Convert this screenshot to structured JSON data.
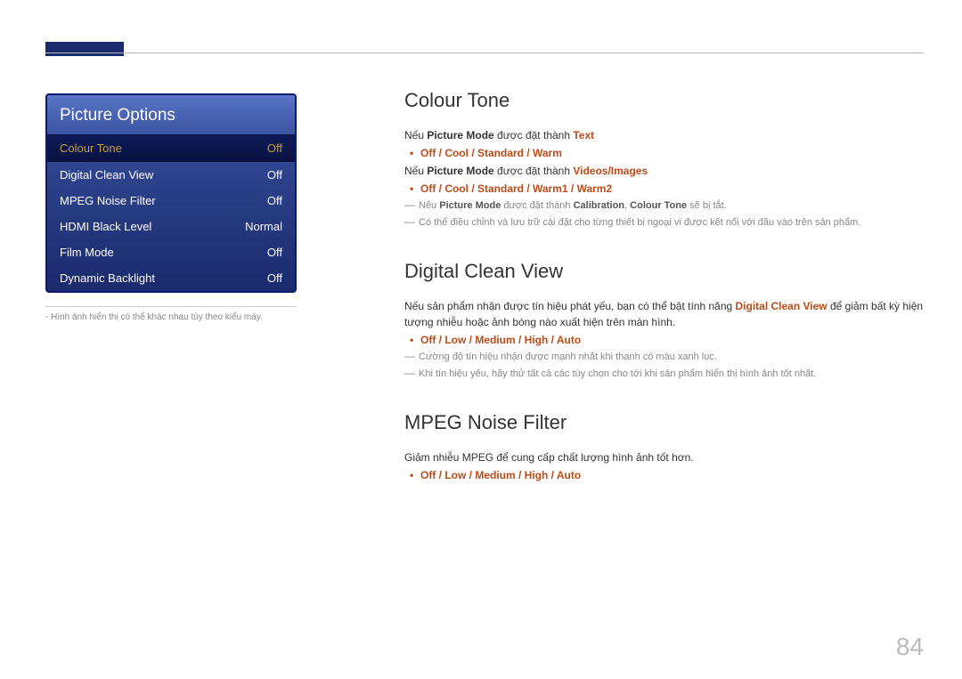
{
  "page_number": "84",
  "panel": {
    "title": "Picture Options",
    "rows": [
      {
        "label": "Colour Tone",
        "value": "Off",
        "selected": true
      },
      {
        "label": "Digital Clean View",
        "value": "Off"
      },
      {
        "label": "MPEG Noise Filter",
        "value": "Off"
      },
      {
        "label": "HDMI Black Level",
        "value": "Normal"
      },
      {
        "label": "Film Mode",
        "value": "Off"
      },
      {
        "label": "Dynamic Backlight",
        "value": "Off"
      }
    ],
    "footnote": "- Hình ảnh hiển thị có thể khác nhau tùy theo kiểu máy."
  },
  "sections": {
    "colour_tone": {
      "title": "Colour Tone",
      "line1_a": "Nếu ",
      "line1_b": "Picture Mode",
      "line1_c": " được đặt thành ",
      "line1_d": "Text",
      "bullet1": "Off / Cool / Standard / Warm",
      "line2_a": "Nếu ",
      "line2_b": "Picture Mode",
      "line2_c": " được đặt thành ",
      "line2_d": "Videos/Images",
      "bullet2": "Off / Cool / Standard / Warm1 / Warm2",
      "dash1_a": "Nếu ",
      "dash1_b": "Picture Mode",
      "dash1_c": " được đặt thành ",
      "dash1_d": "Calibration",
      "dash1_e": ", ",
      "dash1_f": "Colour Tone",
      "dash1_g": " sẽ bị tắt.",
      "dash2": "Có thể điều chỉnh và lưu trữ cài đặt cho từng thiết bị ngoại vi được kết nối với đầu vào trên sản phẩm."
    },
    "digital_clean_view": {
      "title": "Digital Clean View",
      "line_a": "Nếu sản phẩm nhận được tín hiệu phát yếu, bạn có thể bật tính năng ",
      "line_b": "Digital Clean View",
      "line_c": " để giảm bất kỳ hiện tượng nhiễu hoặc ảnh bóng nào xuất hiện trên màn hình.",
      "bullet": "Off / Low / Medium / High / Auto",
      "dash1": "Cường độ tín hiệu nhận được mạnh nhất khi thanh có màu xanh lục.",
      "dash2": "Khi tín hiệu yếu, hãy thử tất cả các tùy chọn cho tới khi sản phẩm hiển thị hình ảnh tốt nhất."
    },
    "mpeg_noise_filter": {
      "title": "MPEG Noise Filter",
      "line": "Giảm nhiễu MPEG để cung cấp chất lượng hình ảnh tốt hơn.",
      "bullet": "Off / Low / Medium / High / Auto"
    }
  }
}
